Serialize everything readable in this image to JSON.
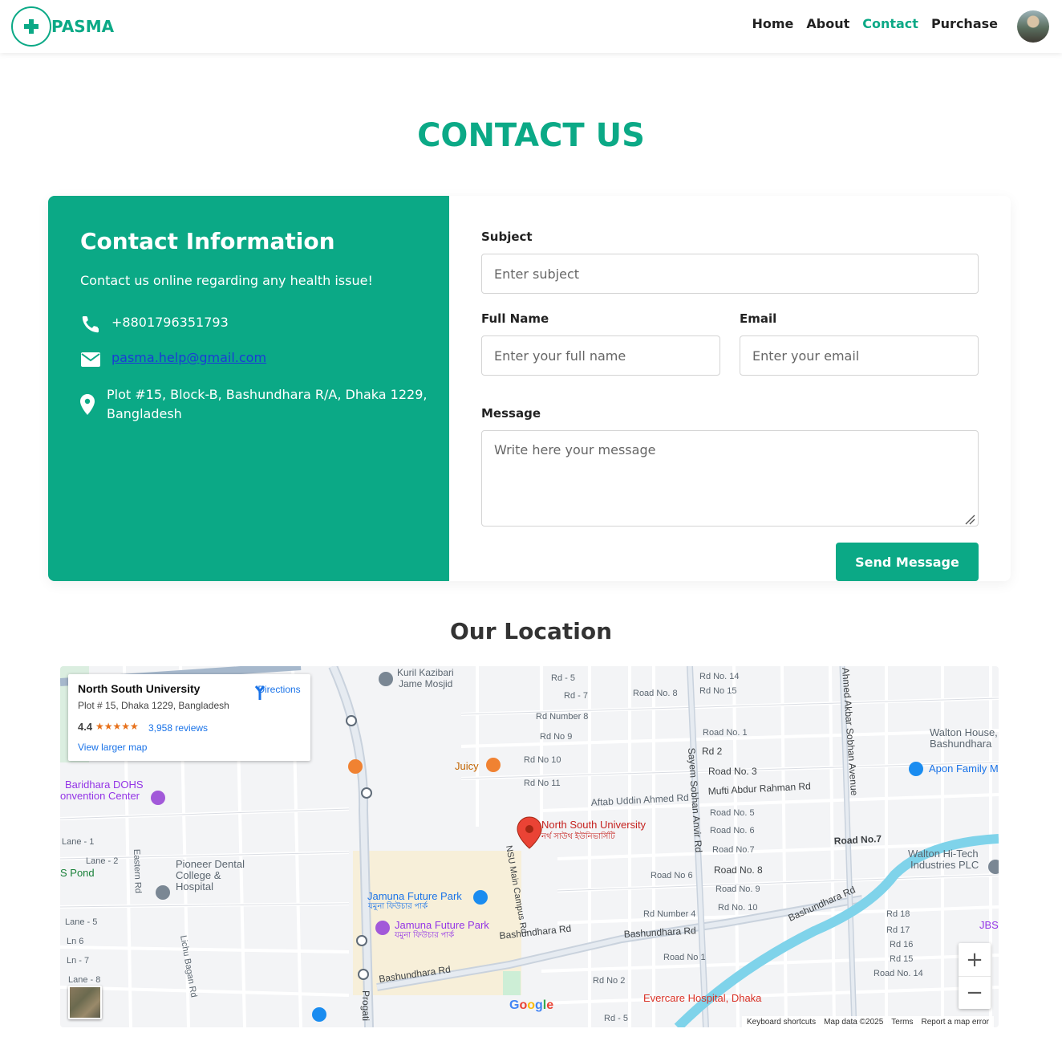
{
  "nav": {
    "brand": "PASMA",
    "links": [
      {
        "label": "Home"
      },
      {
        "label": "About"
      },
      {
        "label": "Contact"
      },
      {
        "label": "Purchase"
      }
    ]
  },
  "page_title": "CONTACT US",
  "contact_info": {
    "heading": "Contact Information",
    "tagline": "Contact us online regarding any health issue!",
    "phone": "+8801796351793",
    "email": "pasma.help@gmail.com",
    "address_line1": "Plot #15, Block-B, Bashundhara R/A, Dhaka 1229,",
    "address_line2": "Bangladesh"
  },
  "form": {
    "subject_label": "Subject",
    "subject_placeholder": "Enter subject",
    "fullname_label": "Full Name",
    "fullname_placeholder": "Enter your full name",
    "email_label": "Email",
    "email_placeholder": "Enter your email",
    "message_label": "Message",
    "message_placeholder": "Write here your message",
    "submit_label": "Send Message"
  },
  "location_title": "Our Location",
  "map": {
    "place_name": "North South University",
    "place_address": "Plot # 15, Dhaka 1229, Bangladesh",
    "rating": "4.4",
    "stars": "★★★★★",
    "reviews": "3,958 reviews",
    "view_larger": "View larger map",
    "directions": "Directions",
    "pin_label": "North South University",
    "pin_label_bn": "নর্থ সাউথ ইউনিভার্সিটি",
    "zoom_in": "+",
    "zoom_out": "−",
    "google": "Google",
    "attribution": [
      "Keyboard shortcuts",
      "Map data ©2025",
      "Terms",
      "Report a map error"
    ],
    "labels": {
      "bashundhara_rd": "Bashundhara Rd",
      "jamuna_future_park": "Jamuna Future Park",
      "jamuna_bn": "যমুনা ফিউচার পার্ক",
      "juicy": "Juicy",
      "baridhara": "Baridhara DOHS",
      "convention": "onvention Center",
      "pioneer": "Pioneer Dental",
      "college": "College &",
      "hospital": "Hospital",
      "evercare": "Evercare Hospital, Dhaka",
      "walton_house": "Walton House,",
      "bashundhara": "Bashundhara",
      "walton_hitech": "Walton Hi-Tech",
      "industries": "Industries PLC",
      "apon": "Apon Family M",
      "sayem": "Sayem Sobhan Anvir Rd",
      "ahmed_akbar": "Ahmed Akbar Sobhan Avenue",
      "mufti": "Mufti Abdur Rahman Rd",
      "aftab": "Aftab Uddin Ahmed Rd",
      "nsu_main": "NSU Main Campus Rd",
      "road7": "Road No.7",
      "road8": "Road No. 8",
      "road3": "Road No. 3",
      "rd2": "Rd 2",
      "rd18": "Rd 18",
      "rd17": "Rd 17",
      "rd16": "Rd 16",
      "rd15": "Rd 15",
      "kuril": "Kuril Kazibari",
      "jame": "Jame Mosjid",
      "s_pond": "S Pond",
      "lane1": "Lane - 1",
      "lane2": "Lane - 2",
      "lane5": "Lane - 5",
      "ln6": "Ln 6",
      "ln7": "Ln - 7",
      "lane8": "Lane - 8",
      "eastern": "Eastern Rd",
      "lichu": "Lichu Bagan Rd",
      "progati": "Progati",
      "jbs": "JBS",
      "rd5a": "Rd - 5",
      "rd7": "Rd - 7",
      "rdnum8": "Rd Number 8",
      "rdno9": "Rd No 9",
      "rdno10": "Rd No 10",
      "rdno11": "Rd No 11",
      "roadno8b": "Road No. 8",
      "rdno14": "Rd No. 14",
      "rdno15": "Rd No 15",
      "roadno1": "Road No. 1",
      "roadno5": "Road No. 5",
      "roadno6": "Road No. 6",
      "roadno7b": "Road No.7",
      "roadno9": "Road No. 9",
      "roadno10": "Rd No. 10",
      "rdnum4": "Rd Number 4",
      "roadno1b": "Road No 1",
      "rdno2": "Rd No 2",
      "rd5b": "Rd - 5",
      "rdno14b": "Road No. 14",
      "roadno6b": "Road No 6"
    }
  },
  "colors": {
    "accent": "#0ba986",
    "link": "#1a3bd6"
  }
}
